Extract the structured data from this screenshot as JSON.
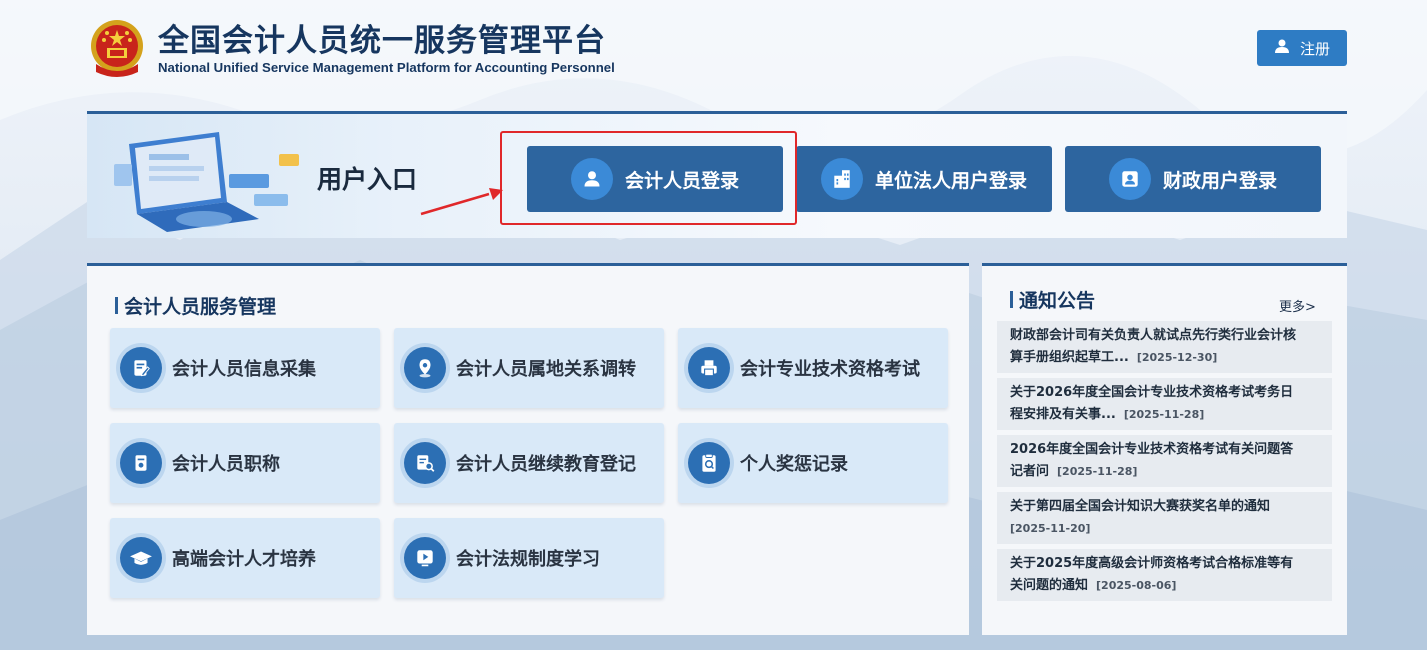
{
  "header": {
    "title": "全国会计人员统一服务管理平台",
    "subtitle": "National Unified Service Management Platform for Accounting Personnel",
    "register_label": "注册"
  },
  "entry": {
    "label": "用户入口",
    "buttons": [
      {
        "label": "会计人员登录",
        "icon": "user-icon"
      },
      {
        "label": "单位法人用户登录",
        "icon": "building-icon"
      },
      {
        "label": "财政用户登录",
        "icon": "id-card-icon"
      }
    ]
  },
  "services": {
    "title": "会计人员服务管理",
    "items": [
      {
        "label": "会计人员信息采集",
        "icon": "edit-document-icon"
      },
      {
        "label": "会计人员属地关系调转",
        "icon": "location-pin-icon"
      },
      {
        "label": "会计专业技术资格考试",
        "icon": "printer-icon"
      },
      {
        "label": "会计人员职称",
        "icon": "certificate-icon"
      },
      {
        "label": "会计人员继续教育登记",
        "icon": "document-search-icon"
      },
      {
        "label": "个人奖惩记录",
        "icon": "clipboard-search-icon"
      },
      {
        "label": "高端会计人才培养",
        "icon": "graduation-cap-icon"
      },
      {
        "label": "会计法规制度学习",
        "icon": "video-play-icon"
      }
    ]
  },
  "notice": {
    "title": "通知公告",
    "more": "更多>",
    "items": [
      {
        "line1": "财政部会计司有关负责人就试点先行类行业会计核",
        "line2": "算手册组织起草工...",
        "date": "[2025-12-30]"
      },
      {
        "line1": "关于2026年度全国会计专业技术资格考试考务日",
        "line2": "程安排及有关事...",
        "date": "[2025-11-28]"
      },
      {
        "line1": "2026年度全国会计专业技术资格考试有关问题答",
        "line2": "记者问",
        "date": "[2025-11-28]"
      },
      {
        "line1": "关于第四届全国会计知识大赛获奖名单的通知",
        "line2": "",
        "date": "[2025-11-20]"
      },
      {
        "line1": "关于2025年度高级会计师资格考试合格标准等有",
        "line2": "关问题的通知",
        "date": "[2025-08-06]"
      }
    ]
  },
  "colors": {
    "primary": "#2d659f",
    "accent": "#2e7cc4",
    "highlight": "#e0282a",
    "card_bg": "#d9e9f8"
  }
}
